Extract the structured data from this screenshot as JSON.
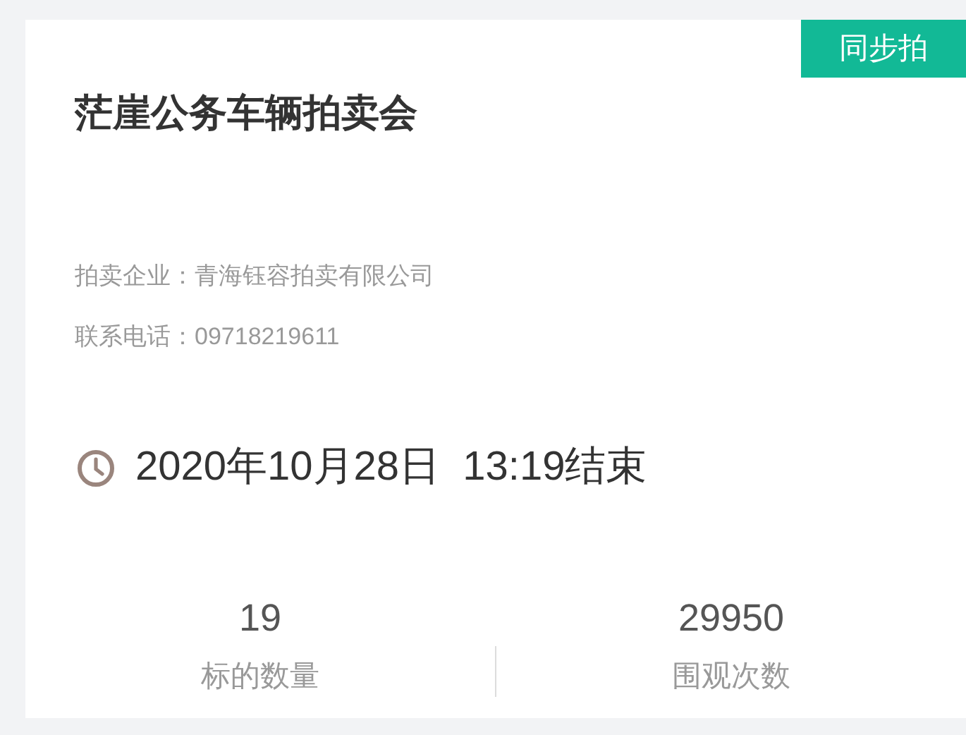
{
  "badge": "同步拍",
  "title": "茫崖公务车辆拍卖会",
  "info": [
    {
      "label": "拍卖企业：",
      "value": "青海钰容拍卖有限公司"
    },
    {
      "label": "联系电话：",
      "value": "09718219611"
    }
  ],
  "end_time": "2020年10月28日  13:19结束",
  "stats": [
    {
      "value": "19",
      "label": "标的数量"
    },
    {
      "value": "29950",
      "label": "围观次数"
    }
  ]
}
